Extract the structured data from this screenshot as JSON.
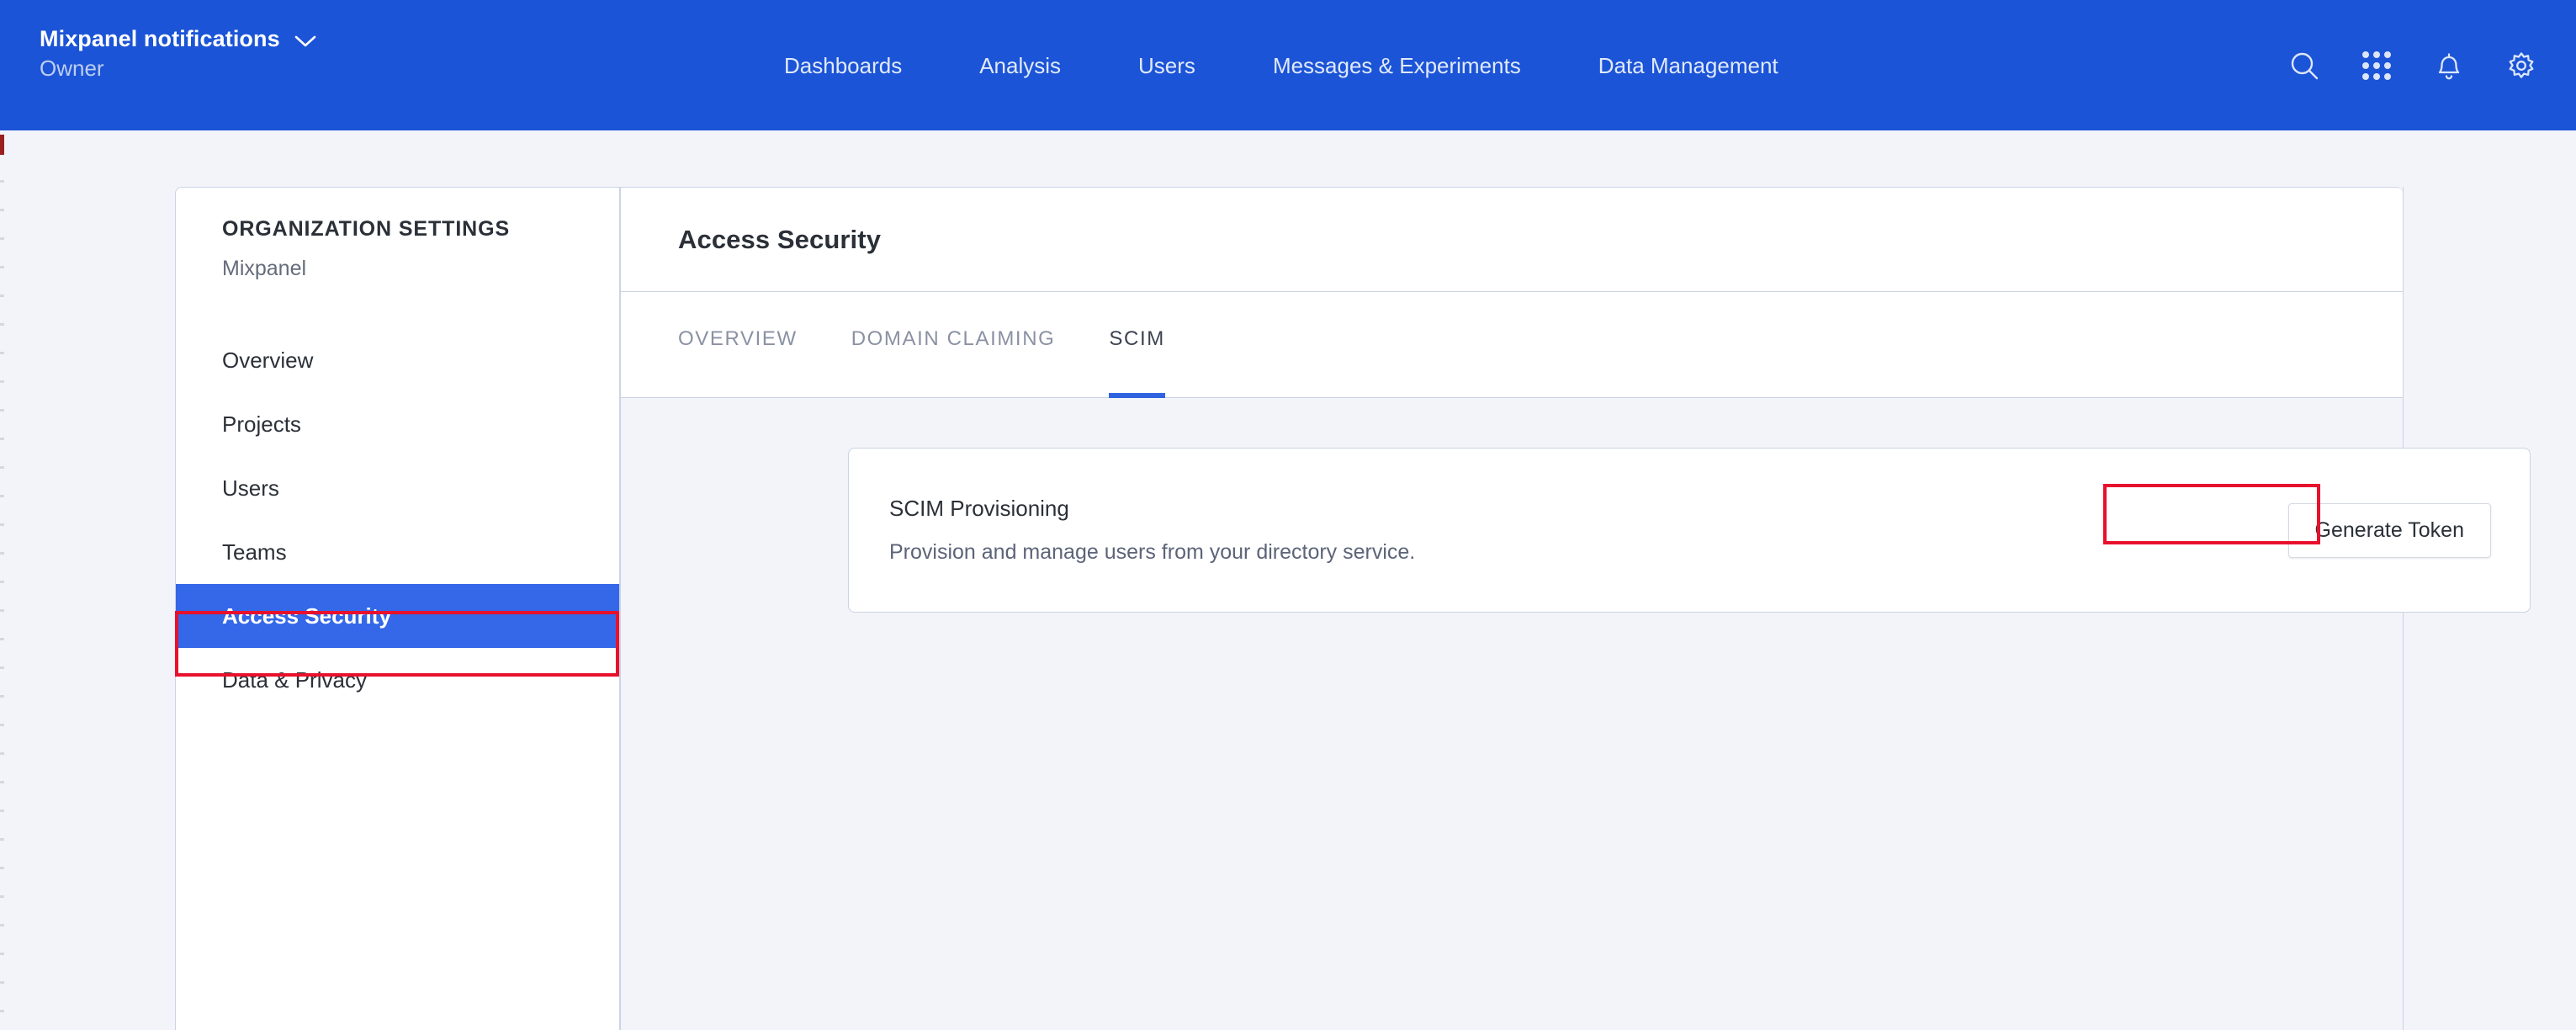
{
  "topbar": {
    "org_name": "Mixpanel notifications",
    "org_role": "Owner",
    "chevron_icon": "chevron-down-icon",
    "nav_items": [
      {
        "label": "Dashboards"
      },
      {
        "label": "Analysis"
      },
      {
        "label": "Users"
      },
      {
        "label": "Messages & Experiments"
      },
      {
        "label": "Data Management"
      }
    ],
    "actions": [
      {
        "icon": "search-icon"
      },
      {
        "icon": "apps-grid-icon"
      },
      {
        "icon": "bell-icon"
      },
      {
        "icon": "gear-icon"
      }
    ],
    "background_color": "#1b54d6"
  },
  "sidebar": {
    "eyebrow": "ORGANIZATION SETTINGS",
    "org": "Mixpanel",
    "items": [
      {
        "label": "Overview",
        "active": false
      },
      {
        "label": "Projects",
        "active": false
      },
      {
        "label": "Users",
        "active": false
      },
      {
        "label": "Teams",
        "active": false
      },
      {
        "label": "Access Security",
        "active": true
      },
      {
        "label": "Data & Privacy",
        "active": false
      }
    ],
    "active_color": "#3468e8"
  },
  "panel": {
    "title": "Access Security",
    "tabs": [
      {
        "label": "OVERVIEW",
        "active": false
      },
      {
        "label": "DOMAIN CLAIMING",
        "active": false
      },
      {
        "label": "SCIM",
        "active": true
      }
    ],
    "active_tab_underline_color": "#2f63e0",
    "card": {
      "title": "SCIM Provisioning",
      "description": "Provision and manage users from your directory service.",
      "button_label": "Generate Token"
    }
  },
  "annotations": {
    "color": "#e8112d",
    "targets": [
      "sidebar-item-access-security",
      "generate-token-button"
    ]
  }
}
